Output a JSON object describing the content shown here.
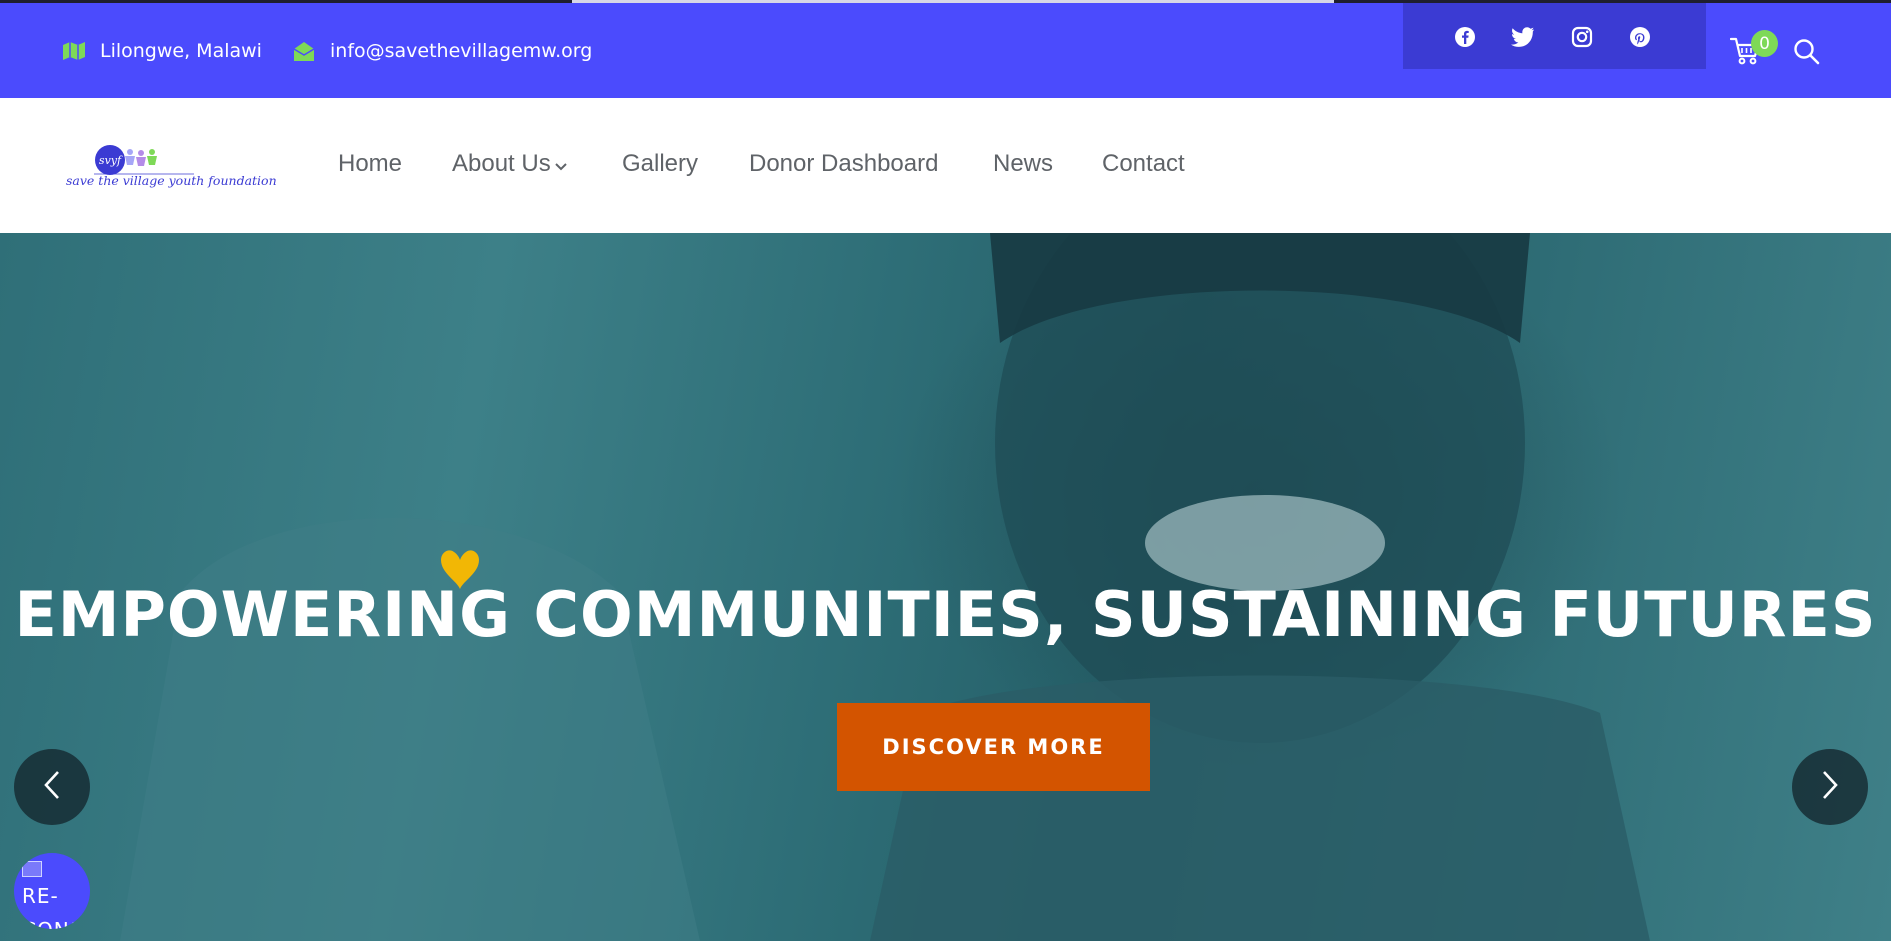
{
  "topbar": {
    "location": "Lilongwe, Malawi",
    "email": "info@savethevillagemw.org",
    "social": [
      "facebook-icon",
      "twitter-icon",
      "instagram-icon",
      "pinterest-icon"
    ],
    "cart_count": "0"
  },
  "logo": {
    "tagline": "save the village youth foundation",
    "mark": "svyf"
  },
  "nav": {
    "items": [
      "Home",
      "About Us",
      "Gallery",
      "Donor Dashboard",
      "News",
      "Contact"
    ]
  },
  "hero": {
    "headline": "EMPOWERING COMMUNITIES, SUSTAINING FUTURES",
    "cta": "DISCOVER MORE"
  },
  "widget": {
    "label": "RE-CONS"
  },
  "colors": {
    "topbar": "#4b4bfd",
    "social_box": "#3b3bd3",
    "icon_green": "#7ed957",
    "cta": "#d35400",
    "hero_tint": "#2f6f78"
  }
}
